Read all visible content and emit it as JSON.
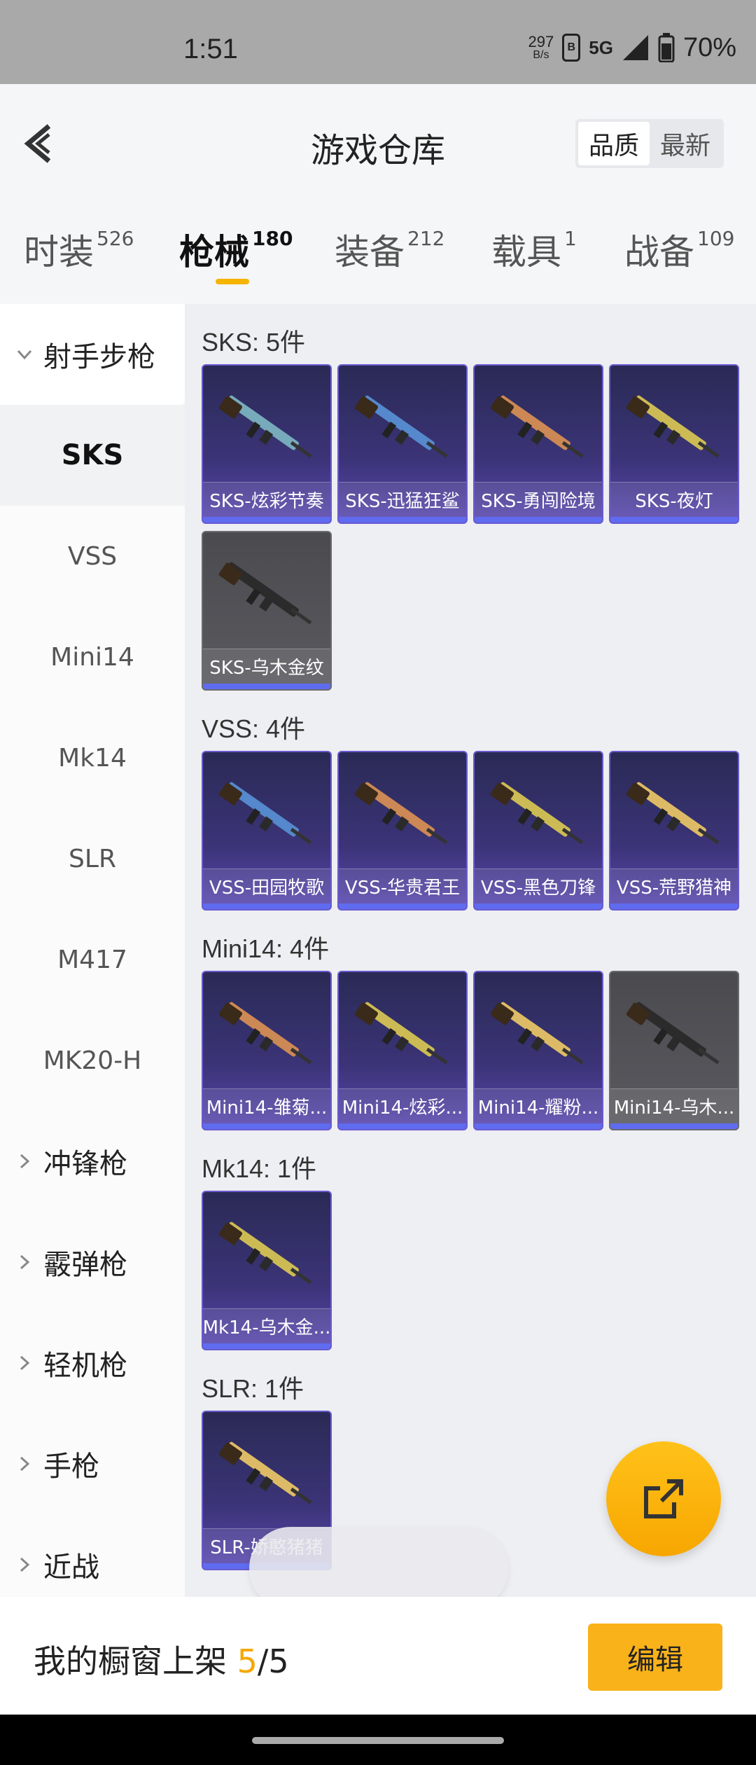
{
  "status_bar": {
    "time": "1:51",
    "net_speed_value": "297",
    "net_speed_unit": "B/s",
    "network": "5G",
    "battery": "70%"
  },
  "header": {
    "title": "游戏仓库",
    "sort_options": [
      "品质",
      "最新"
    ],
    "sort_selected": "品质"
  },
  "tabs": [
    {
      "label": "时装",
      "count": "526"
    },
    {
      "label": "枪械",
      "count": "180",
      "active": true
    },
    {
      "label": "装备",
      "count": "212"
    },
    {
      "label": "载具",
      "count": "1"
    },
    {
      "label": "战备",
      "count": "109"
    }
  ],
  "sidebar": {
    "open_group": "射手步枪",
    "sub_items": [
      "SKS",
      "VSS",
      "Mini14",
      "Mk14",
      "SLR",
      "M417",
      "MK20-H"
    ],
    "selected": "SKS",
    "groups": [
      "冲锋枪",
      "霰弹枪",
      "轻机枪",
      "手枪",
      "近战"
    ]
  },
  "sections": [
    {
      "title": "SKS: 5件",
      "items": [
        {
          "name": "SKS-炫彩节奏",
          "grey": false
        },
        {
          "name": "SKS-迅猛狂鲨",
          "grey": false
        },
        {
          "name": "SKS-勇闯险境",
          "grey": false
        },
        {
          "name": "SKS-夜灯",
          "grey": false
        },
        {
          "name": "SKS-乌木金纹",
          "grey": true
        }
      ]
    },
    {
      "title": "VSS: 4件",
      "items": [
        {
          "name": "VSS-田园牧歌",
          "grey": false
        },
        {
          "name": "VSS-华贵君王",
          "grey": false
        },
        {
          "name": "VSS-黑色刀锋",
          "grey": false
        },
        {
          "name": "VSS-荒野猎神",
          "grey": false
        }
      ]
    },
    {
      "title": "Mini14: 4件",
      "items": [
        {
          "name": "Mini14-雏菊...",
          "grey": false
        },
        {
          "name": "Mini14-炫彩...",
          "grey": false
        },
        {
          "name": "Mini14-耀粉...",
          "grey": false
        },
        {
          "name": "Mini14-乌木...",
          "grey": true
        }
      ]
    },
    {
      "title": "Mk14: 1件",
      "items": [
        {
          "name": "Mk14-乌木金...",
          "grey": false
        }
      ]
    },
    {
      "title": "SLR: 1件",
      "items": [
        {
          "name": "SLR-娇憨猪猪",
          "grey": false
        }
      ]
    }
  ],
  "bottom": {
    "showcase_label": "我的橱窗上架",
    "showcase_current": "5",
    "showcase_total": "/5",
    "edit_label": "编辑"
  },
  "colors": {
    "accent": "#f9b21a",
    "card_purple": "#3b3478",
    "card_grey": "#55555a"
  }
}
